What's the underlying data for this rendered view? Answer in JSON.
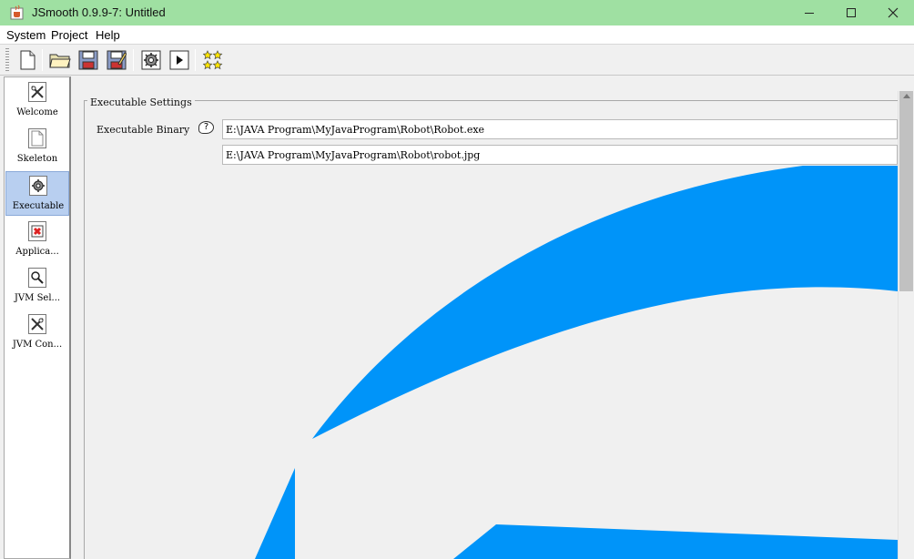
{
  "window": {
    "title": "JSmooth 0.9.9-7: Untitled",
    "icon": "java-cup-icon",
    "controls": [
      "minimize-icon",
      "maximize-icon",
      "close-icon"
    ]
  },
  "menu": {
    "items": [
      "System",
      "Project",
      "Help"
    ]
  },
  "toolbar": {
    "buttons": [
      "new-document-icon",
      "open-folder-icon",
      "save-icon",
      "save-as-icon",
      "compile-gear-icon",
      "run-icon",
      "stars-icon"
    ]
  },
  "sidebar": {
    "items": [
      {
        "label": "Welcome",
        "icon": "tools-icon"
      },
      {
        "label": "Skeleton",
        "icon": "page-icon"
      },
      {
        "label": "Executable",
        "icon": "gear-icon",
        "selected": true
      },
      {
        "label": "Applica...",
        "icon": "application-icon"
      },
      {
        "label": "JVM Sel...",
        "icon": "magnifier-icon"
      },
      {
        "label": "JVM Con...",
        "icon": "tools-icon"
      }
    ]
  },
  "executable": {
    "group_title": "Executable Settings",
    "binary_label": "Executable Binary",
    "help_icon": "?",
    "binary_value": "E:\\JAVA Program\\MyJavaProgram\\Robot\\Robot.exe",
    "icon_value": "E:\\JAVA Program\\MyJavaProgram\\Robot\\robot.jpg"
  },
  "colors": {
    "titlebar": "#9fe0a2",
    "selection": "#b8cff0",
    "robot_image_blue": "#0094f9"
  }
}
